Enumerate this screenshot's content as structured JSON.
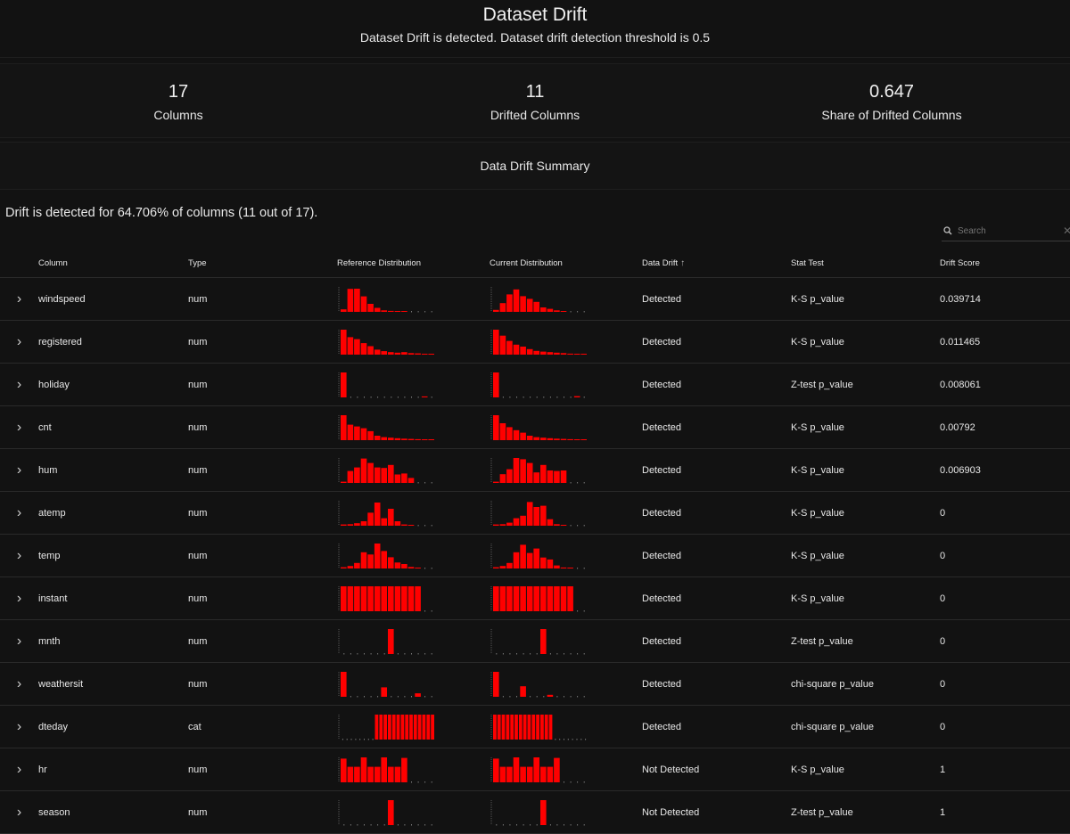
{
  "header": {
    "title": "Dataset Drift",
    "subtitle": "Dataset Drift is detected. Dataset drift detection threshold is 0.5"
  },
  "counters": [
    {
      "value": "17",
      "label": "Columns"
    },
    {
      "value": "11",
      "label": "Drifted Columns"
    },
    {
      "value": "0.647",
      "label": "Share of Drifted Columns"
    }
  ],
  "summary_title": "Data Drift Summary",
  "description": "Drift is detected for 64.706% of columns (11 out of 17).",
  "search": {
    "placeholder": "Search"
  },
  "icons": {
    "search": "search-icon",
    "clear": "close-icon",
    "expand": "chevron-right-icon",
    "sort": "arrow-up-icon"
  },
  "colors": {
    "bar": "#ff0000",
    "background": "#121212"
  },
  "table": {
    "headers": {
      "column": "Column",
      "type": "Type",
      "reference": "Reference Distribution",
      "current": "Current Distribution",
      "drift": "Data Drift",
      "stat_test": "Stat Test",
      "score": "Drift Score"
    },
    "rows": [
      {
        "column": "windspeed",
        "type": "num",
        "drift": "Detected",
        "stat_test": "K-S p_value",
        "score": "0.039714",
        "ref": [
          0.1,
          0.92,
          0.93,
          0.62,
          0.32,
          0.16,
          0.06,
          0.04,
          0.02,
          0.01,
          0,
          0,
          0,
          0
        ],
        "cur": [
          0.08,
          0.35,
          0.7,
          0.9,
          0.63,
          0.52,
          0.4,
          0.18,
          0.12,
          0.06,
          0.02,
          0,
          0,
          0
        ]
      },
      {
        "column": "registered",
        "type": "num",
        "drift": "Detected",
        "stat_test": "K-S p_value",
        "score": "0.011465",
        "ref": [
          1.0,
          0.7,
          0.62,
          0.46,
          0.34,
          0.2,
          0.14,
          0.1,
          0.08,
          0.1,
          0.06,
          0.05,
          0.03,
          0.02
        ],
        "cur": [
          1.0,
          0.76,
          0.55,
          0.4,
          0.32,
          0.22,
          0.15,
          0.12,
          0.1,
          0.08,
          0.06,
          0.04,
          0.03,
          0.02
        ]
      },
      {
        "column": "holiday",
        "type": "num",
        "drift": "Detected",
        "stat_test": "Z-test p_value",
        "score": "0.008061",
        "ref": [
          1.0,
          0,
          0,
          0,
          0,
          0,
          0,
          0,
          0,
          0,
          0,
          0,
          0.04,
          0
        ],
        "cur": [
          1.0,
          0,
          0,
          0,
          0,
          0,
          0,
          0,
          0,
          0,
          0,
          0,
          0.05,
          0
        ]
      },
      {
        "column": "cnt",
        "type": "num",
        "drift": "Detected",
        "stat_test": "K-S p_value",
        "score": "0.00792",
        "ref": [
          1.0,
          0.62,
          0.55,
          0.48,
          0.36,
          0.18,
          0.12,
          0.1,
          0.08,
          0.06,
          0.05,
          0.04,
          0.02,
          0.01
        ],
        "cur": [
          1.0,
          0.68,
          0.52,
          0.4,
          0.3,
          0.18,
          0.12,
          0.1,
          0.08,
          0.06,
          0.05,
          0.04,
          0.03,
          0.02
        ]
      },
      {
        "column": "hum",
        "type": "num",
        "drift": "Detected",
        "stat_test": "K-S p_value",
        "score": "0.006903",
        "ref": [
          0.05,
          0.48,
          0.62,
          0.98,
          0.8,
          0.62,
          0.6,
          0.72,
          0.34,
          0.38,
          0.2,
          0,
          0,
          0
        ],
        "cur": [
          0.05,
          0.35,
          0.55,
          1.0,
          0.95,
          0.8,
          0.42,
          0.72,
          0.5,
          0.48,
          0.5,
          0,
          0,
          0
        ]
      },
      {
        "column": "atemp",
        "type": "num",
        "drift": "Detected",
        "stat_test": "K-S p_value",
        "score": "0.00",
        "ref": [
          0.05,
          0.06,
          0.1,
          0.18,
          0.52,
          0.93,
          0.3,
          0.68,
          0.18,
          0.05,
          0.02,
          0,
          0,
          0
        ],
        "cur": [
          0.05,
          0.06,
          0.12,
          0.3,
          0.4,
          0.95,
          0.75,
          0.8,
          0.26,
          0.06,
          0.02,
          0,
          0,
          0
        ]
      },
      {
        "column": "temp",
        "type": "num",
        "drift": "Detected",
        "stat_test": "K-S p_value",
        "score": "0",
        "ref": [
          0.05,
          0.1,
          0.22,
          0.65,
          0.56,
          1.0,
          0.7,
          0.45,
          0.24,
          0.18,
          0.06,
          0.02,
          0,
          0
        ],
        "cur": [
          0.05,
          0.1,
          0.22,
          0.65,
          0.95,
          0.62,
          0.8,
          0.44,
          0.36,
          0.12,
          0.04,
          0.02,
          0,
          0
        ]
      },
      {
        "column": "instant",
        "type": "num",
        "drift": "Detected",
        "stat_test": "K-S p_value",
        "score": "0",
        "ref": [
          1,
          1,
          1,
          1,
          1,
          1,
          1,
          1,
          1,
          1,
          1,
          1,
          0,
          0
        ],
        "cur": [
          1,
          1,
          1,
          1,
          1,
          1,
          1,
          1,
          1,
          1,
          1,
          1,
          0,
          0
        ]
      },
      {
        "column": "mnth",
        "type": "num",
        "drift": "Detected",
        "stat_test": "Z-test p_value",
        "score": "0",
        "ref": [
          0,
          0,
          0,
          0,
          0,
          0,
          0,
          1.0,
          0,
          0,
          0,
          0,
          0,
          0
        ],
        "cur": [
          0,
          0,
          0,
          0,
          0,
          0,
          0,
          1.0,
          0,
          0,
          0,
          0,
          0,
          0
        ]
      },
      {
        "column": "weathersit",
        "type": "num",
        "drift": "Detected",
        "stat_test": "chi-square p_value",
        "score": "0",
        "ref": [
          1.0,
          0,
          0,
          0,
          0,
          0,
          0.38,
          0,
          0,
          0,
          0,
          0.14,
          0,
          0
        ],
        "cur": [
          1.0,
          0,
          0,
          0,
          0.42,
          0,
          0,
          0,
          0.08,
          0,
          0,
          0,
          0,
          0
        ]
      },
      {
        "column": "dteday",
        "type": "cat",
        "drift": "Detected",
        "stat_test": "chi-square p_value",
        "score": "0",
        "ref": [
          0,
          0,
          0,
          0,
          0,
          0,
          0,
          0,
          1,
          1,
          1,
          1,
          1,
          1,
          1,
          1,
          1,
          1,
          1,
          1,
          1,
          1
        ],
        "cur": [
          1,
          1,
          1,
          1,
          1,
          1,
          1,
          1,
          1,
          1,
          1,
          1,
          1,
          1,
          0,
          0,
          0,
          0,
          0,
          0,
          0,
          0
        ]
      },
      {
        "column": "hr",
        "type": "num",
        "drift": "Not Detected",
        "stat_test": "K-S p_value",
        "score": "1",
        "ref": [
          0.95,
          0.62,
          0.62,
          1.0,
          0.62,
          0.62,
          1.0,
          0.62,
          0.62,
          0.98,
          0,
          0,
          0,
          0
        ],
        "cur": [
          0.95,
          0.62,
          0.62,
          1.0,
          0.62,
          0.62,
          1.0,
          0.62,
          0.62,
          0.98,
          0,
          0,
          0,
          0
        ]
      },
      {
        "column": "season",
        "type": "num",
        "drift": "Not Detected",
        "stat_test": "Z-test p_value",
        "score": "1",
        "ref": [
          0,
          0,
          0,
          0,
          0,
          0,
          0,
          1.0,
          0,
          0,
          0,
          0,
          0,
          0
        ],
        "cur": [
          0,
          0,
          0,
          0,
          0,
          0,
          0,
          1.0,
          0,
          0,
          0,
          0,
          0,
          0
        ]
      }
    ]
  }
}
